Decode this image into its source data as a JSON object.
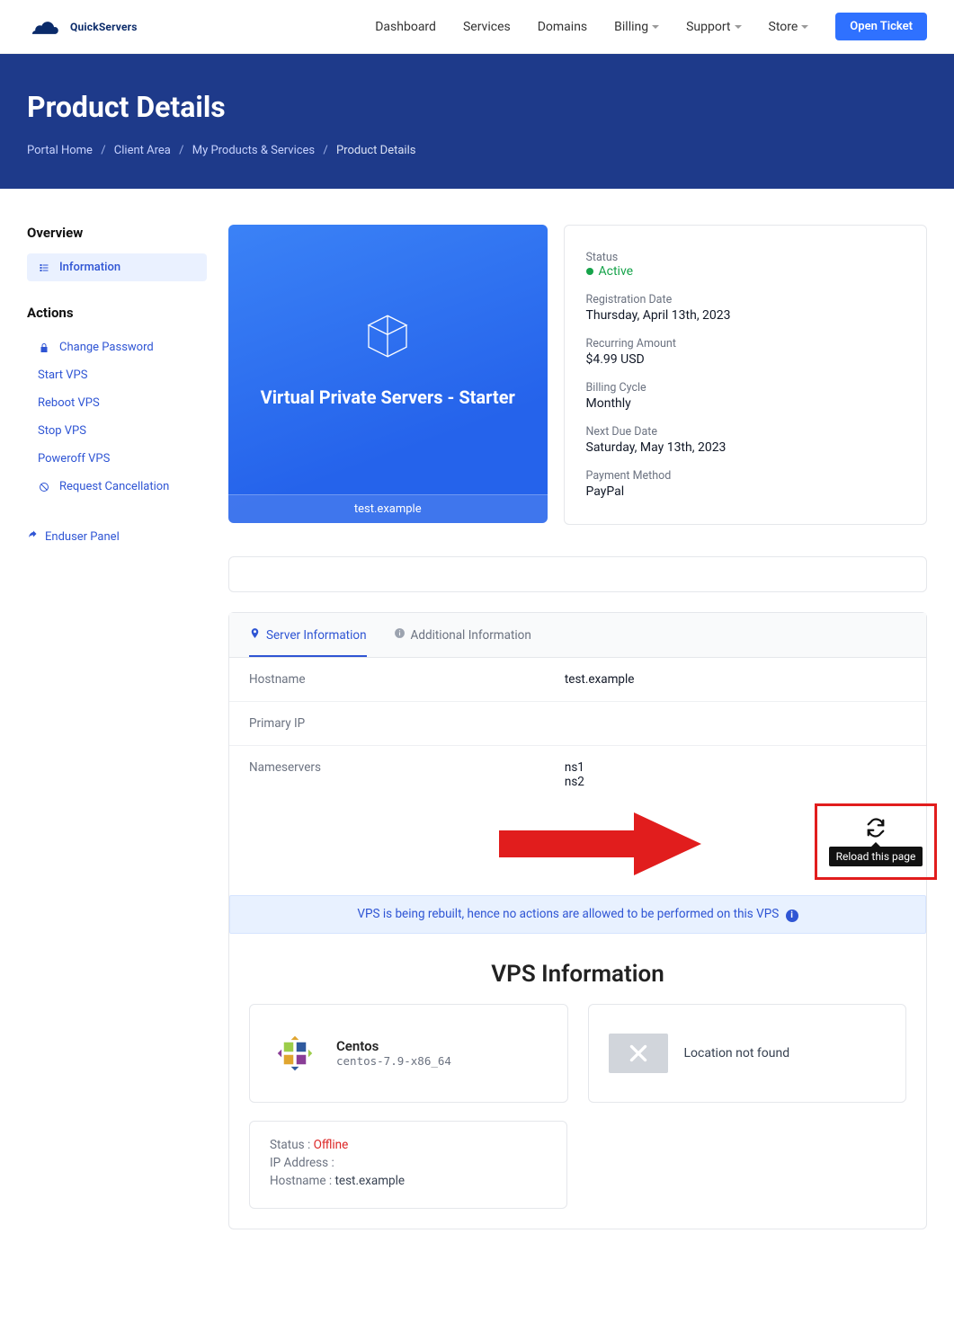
{
  "brand": "QuickServers",
  "nav": {
    "items": [
      {
        "label": "Dashboard",
        "caret": false
      },
      {
        "label": "Services",
        "caret": false
      },
      {
        "label": "Domains",
        "caret": false
      },
      {
        "label": "Billing",
        "caret": true
      },
      {
        "label": "Support",
        "caret": true
      },
      {
        "label": "Store",
        "caret": true
      }
    ],
    "cta": "Open Ticket"
  },
  "hero": {
    "title": "Product Details",
    "breadcrumbs": [
      "Portal Home",
      "Client Area",
      "My Products & Services",
      "Product Details"
    ]
  },
  "sidebar": {
    "overviewTitle": "Overview",
    "overviewItems": [
      {
        "label": "Information",
        "icon": "info-list-icon",
        "active": true
      }
    ],
    "actionsTitle": "Actions",
    "actionItems": [
      {
        "label": "Change Password",
        "icon": "lock-icon"
      },
      {
        "label": "Start VPS"
      },
      {
        "label": "Reboot VPS"
      },
      {
        "label": "Stop VPS"
      },
      {
        "label": "Poweroff VPS"
      },
      {
        "label": "Request Cancellation",
        "icon": "ban-icon"
      }
    ],
    "enduser": "Enduser Panel"
  },
  "product": {
    "name": "Virtual Private Servers - Starter",
    "hostname": "test.example"
  },
  "info": {
    "status_label": "Status",
    "status_value": "Active",
    "regdate_label": "Registration Date",
    "regdate_value": "Thursday, April 13th, 2023",
    "recurring_label": "Recurring Amount",
    "recurring_value": "$4.99 USD",
    "cycle_label": "Billing Cycle",
    "cycle_value": "Monthly",
    "nextdue_label": "Next Due Date",
    "nextdue_value": "Saturday, May 13th, 2023",
    "paymethod_label": "Payment Method",
    "paymethod_value": "PayPal"
  },
  "tabs": {
    "server": "Server Information",
    "additional": "Additional Information"
  },
  "server": {
    "hostname_label": "Hostname",
    "hostname": "test.example",
    "primaryip_label": "Primary IP",
    "primaryip": "",
    "ns_label": "Nameservers",
    "ns": [
      "ns1",
      "ns2"
    ]
  },
  "reload": {
    "tooltip": "Reload this page"
  },
  "notice": "VPS is being rebuilt, hence no actions are allowed to be performed on this VPS",
  "vps": {
    "section_title": "VPS Information",
    "os_name": "Centos",
    "os_slug": "centos-7.9-x86_64",
    "location": "Location not found",
    "status_label": "Status :",
    "status_value": "Offline",
    "ip_label": "IP Address :",
    "ip_value": "",
    "hostname_label": "Hostname :",
    "hostname_value": "test.example"
  }
}
